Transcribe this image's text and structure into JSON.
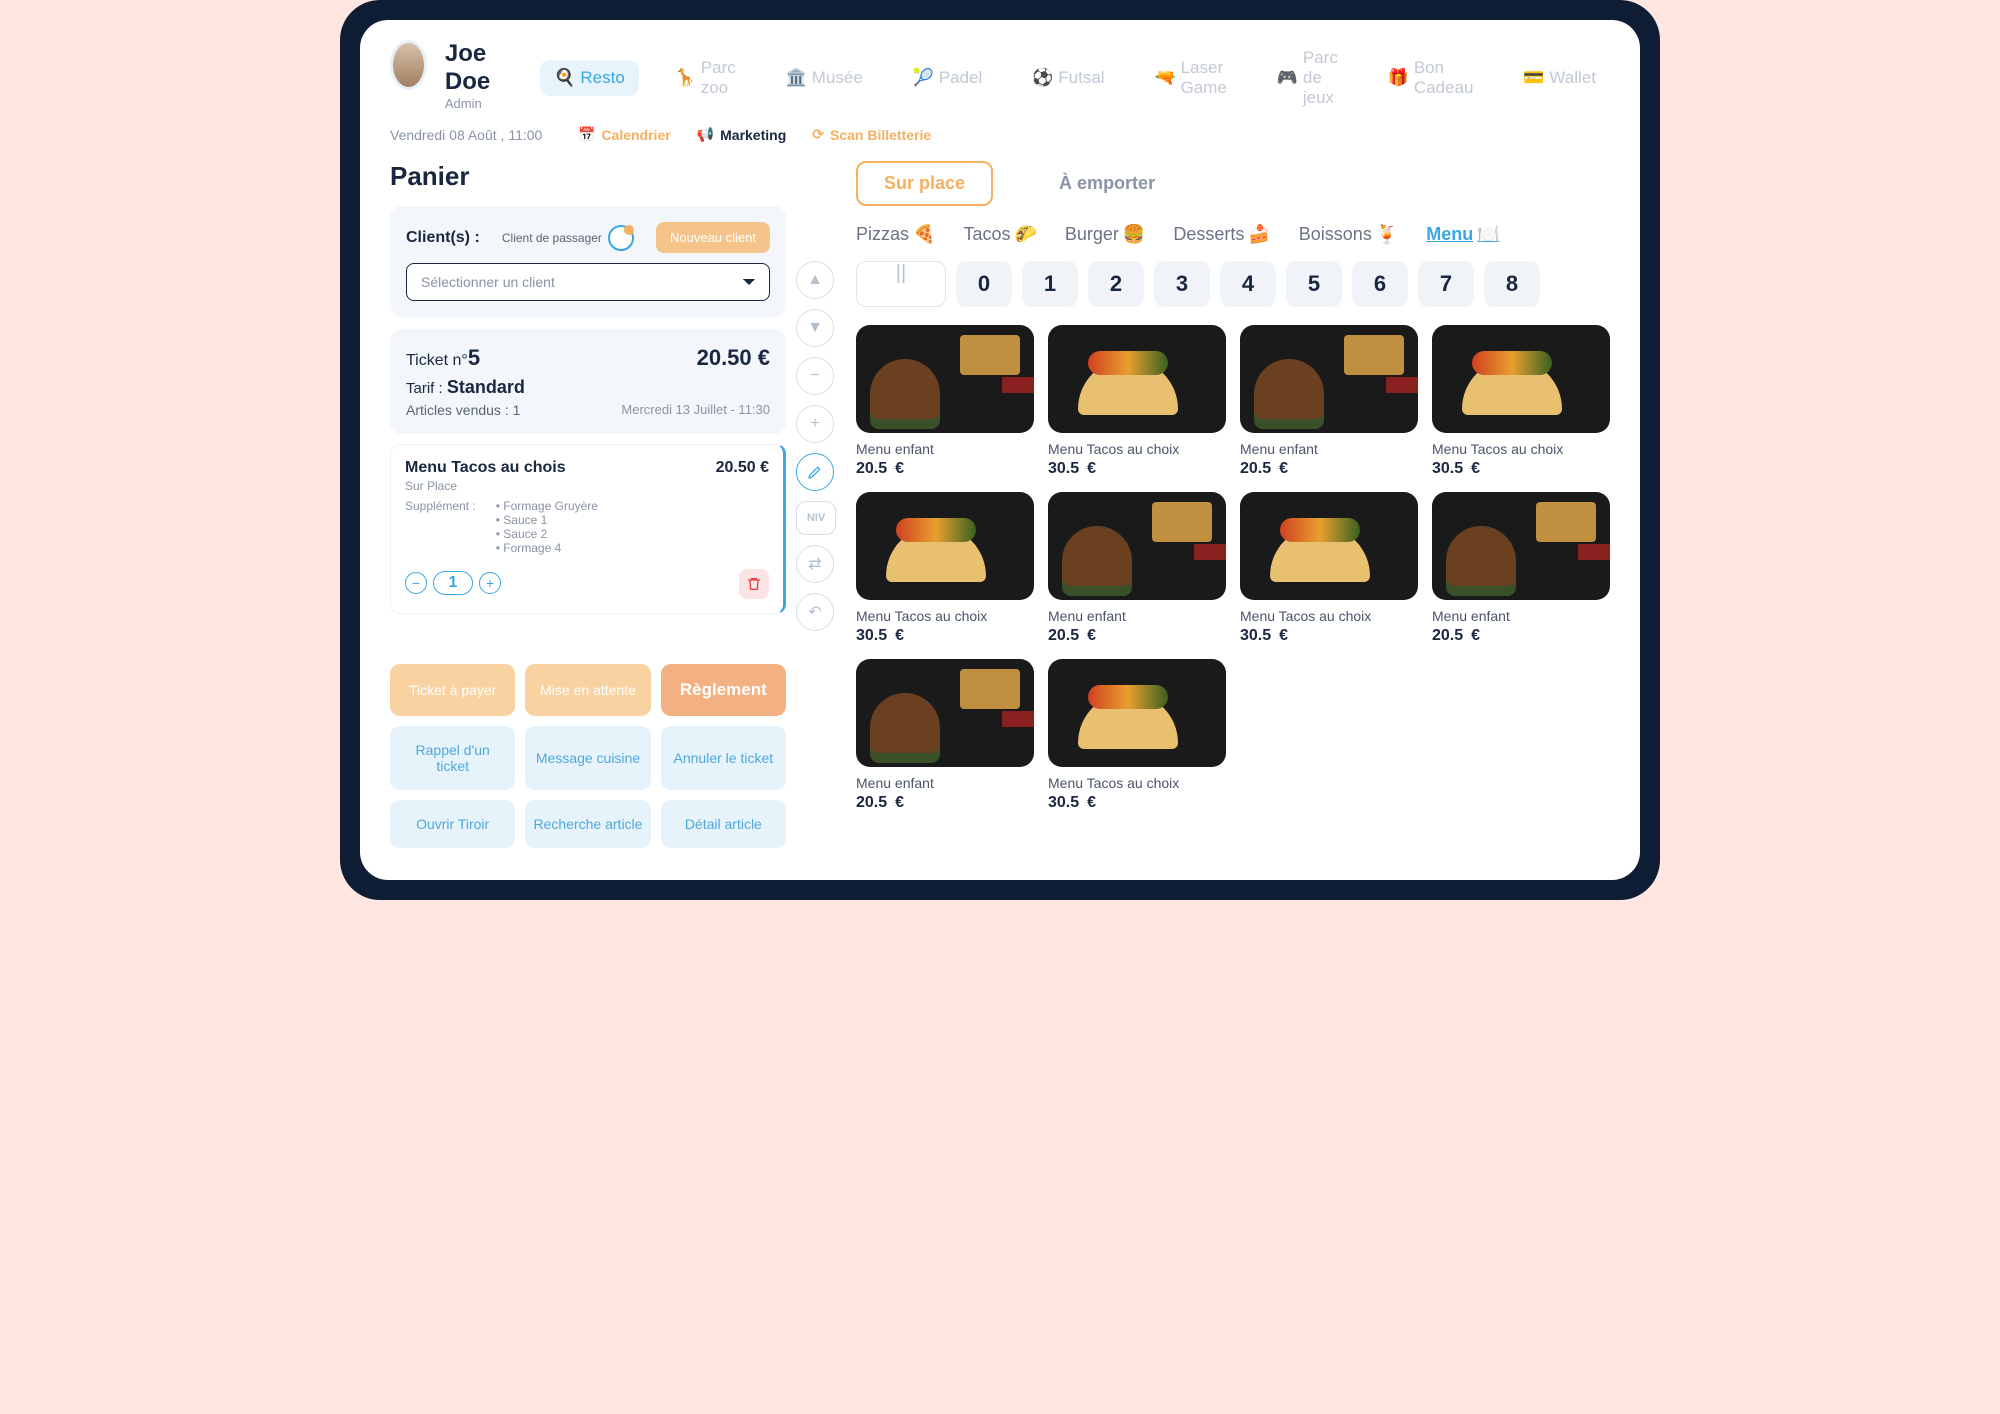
{
  "user": {
    "name": "Joe Doe",
    "role": "Admin"
  },
  "date": "Vendredi 08 Août , 11:00",
  "nav": [
    {
      "label": "Resto",
      "active": true
    },
    {
      "label": "Parc zoo",
      "active": false
    },
    {
      "label": "Musée",
      "active": false
    },
    {
      "label": "Padel",
      "active": false
    },
    {
      "label": "Futsal",
      "active": false
    },
    {
      "label": "Laser Game",
      "active": false
    },
    {
      "label": "Parc de jeux",
      "active": false
    },
    {
      "label": "Bon Cadeau",
      "active": false
    },
    {
      "label": "Wallet",
      "active": false
    }
  ],
  "subnav": {
    "calendrier": "Calendrier",
    "marketing": "Marketing",
    "scan": "Scan Billetterie"
  },
  "panier": {
    "title": "Panier",
    "clients_label": "Client(s) :",
    "client_passager": "Client de passager",
    "new_client": "Nouveau client",
    "select_placeholder": "Sélectionner un client"
  },
  "ticket": {
    "no_label": "Ticket n°",
    "no": "5",
    "total": "20.50 €",
    "tarif_label": "Tarif :",
    "tarif": "Standard",
    "articles_label": "Articles vendus :",
    "articles": "1",
    "date": "Mercredi 13 Juillet - 11:30"
  },
  "cart_item": {
    "name": "Menu Tacos au chois",
    "mode": "Sur Place",
    "supp_label": "Supplément :",
    "supps": [
      "Formage Gruyère",
      "Sauce 1",
      "Sauce 2",
      "Formage 4"
    ],
    "price": "20.50 €",
    "qty": "1"
  },
  "actions": {
    "ticket_payer": "Ticket à payer",
    "mise_attente": "Mise en attente",
    "reglement": "Règlement",
    "rappel": "Rappel d'un ticket",
    "msg_cuisine": "Message cuisine",
    "annuler": "Annuler le ticket",
    "ouvrir_tiroir": "Ouvrir Tiroir",
    "recherche": "Recherche article",
    "detail": "Détail article"
  },
  "mid_controls": {
    "niv": "NIV"
  },
  "modes": {
    "sur_place": "Sur place",
    "a_emporter": "À emporter"
  },
  "categories": [
    {
      "label": "Pizzas",
      "emoji": "🍕",
      "active": false
    },
    {
      "label": "Tacos",
      "emoji": "🌮",
      "active": false
    },
    {
      "label": "Burger",
      "emoji": "🍔",
      "active": false
    },
    {
      "label": "Desserts",
      "emoji": "🍰",
      "active": false
    },
    {
      "label": "Boissons",
      "emoji": "🍹",
      "active": false
    },
    {
      "label": "Menu",
      "emoji": "🍽️",
      "active": true
    }
  ],
  "numpad": [
    "0",
    "1",
    "2",
    "3",
    "4",
    "5",
    "6",
    "7",
    "8"
  ],
  "currency": "€",
  "menu_items": [
    {
      "name": "Menu enfant",
      "price": "20.5",
      "img": "burger"
    },
    {
      "name": "Menu Tacos au choix",
      "price": "30.5",
      "img": "tacos"
    },
    {
      "name": "Menu enfant",
      "price": "20.5",
      "img": "burger"
    },
    {
      "name": "Menu Tacos au choix",
      "price": "30.5",
      "img": "tacos"
    },
    {
      "name": "Menu Tacos au choix",
      "price": "30.5",
      "img": "tacos"
    },
    {
      "name": "Menu enfant",
      "price": "20.5",
      "img": "burger"
    },
    {
      "name": "Menu Tacos au choix",
      "price": "30.5",
      "img": "tacos"
    },
    {
      "name": "Menu enfant",
      "price": "20.5",
      "img": "burger"
    },
    {
      "name": "Menu enfant",
      "price": "20.5",
      "img": "burger"
    },
    {
      "name": "Menu Tacos au choix",
      "price": "30.5",
      "img": "tacos"
    }
  ]
}
